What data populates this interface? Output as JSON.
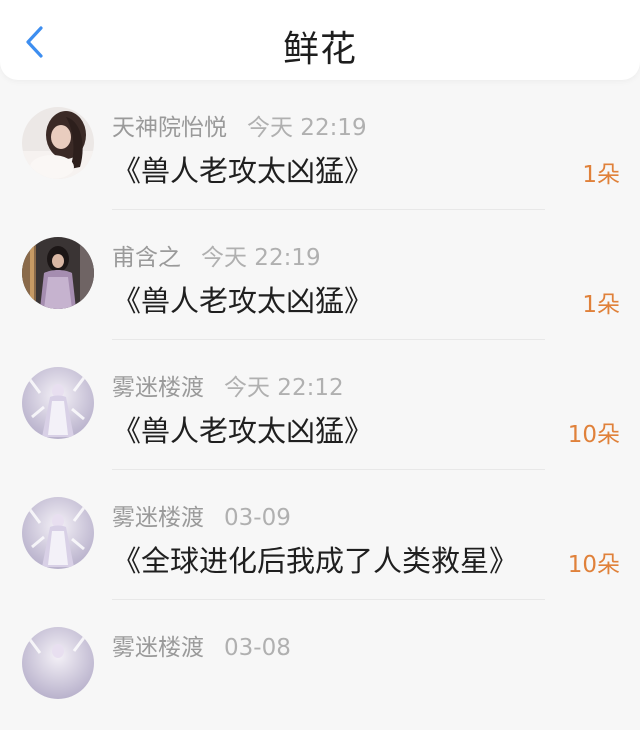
{
  "header": {
    "title": "鲜花",
    "back_icon": "chevron-left-icon",
    "accent": "#3d8ef0"
  },
  "list": {
    "count_color": "#e0813a",
    "items": [
      {
        "name": "天神院怡悦",
        "time": "今天 22:19",
        "book": "《兽人老攻太凶猛》",
        "count": "1朵",
        "avatar": "avatar-photo-girl"
      },
      {
        "name": "甫含之",
        "time": "今天 22:19",
        "book": "《兽人老攻太凶猛》",
        "count": "1朵",
        "avatar": "avatar-photo-girl"
      },
      {
        "name": "雾迷楼渡",
        "time": "今天 22:12",
        "book": "《兽人老攻太凶猛》",
        "count": "10朵",
        "avatar": "avatar-fantasy-art"
      },
      {
        "name": "雾迷楼渡",
        "time": "03-09",
        "book": "《全球进化后我成了人类救星》",
        "count": "10朵",
        "avatar": "avatar-fantasy-art"
      },
      {
        "name": "雾迷楼渡",
        "time": "03-08",
        "book": "",
        "count": "",
        "avatar": "avatar-fantasy-art"
      }
    ]
  }
}
